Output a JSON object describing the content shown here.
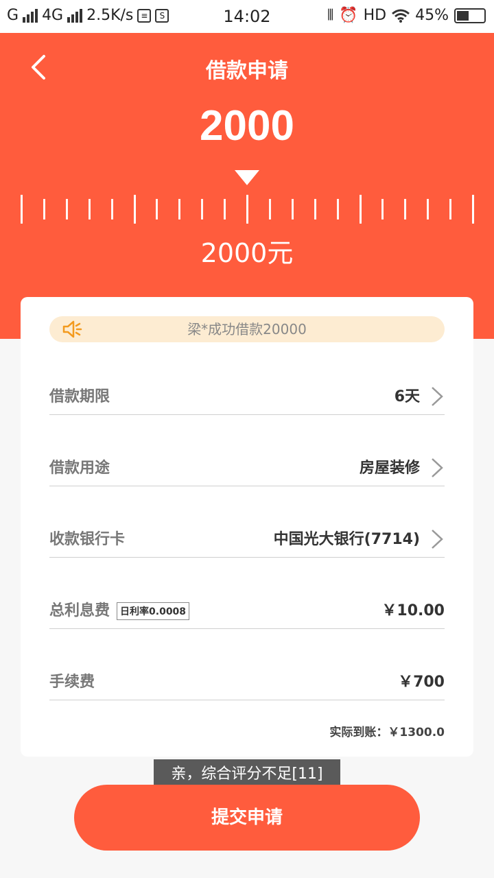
{
  "status_bar": {
    "carrier1": "G",
    "carrier2": "4G",
    "speed": "2.5K/s",
    "time": "14:02",
    "hd": "HD",
    "battery": "45%",
    "battery_level": 0.45
  },
  "header": {
    "title": "借款申请",
    "amount_big": "2000",
    "amount_label": "2000元",
    "bg_color": "#ff5c3d"
  },
  "card": {
    "notice": "梁*成功借款20000",
    "rows": [
      {
        "label": "借款期限",
        "value": "6天"
      },
      {
        "label": "借款用途",
        "value": "房屋装修"
      },
      {
        "label": "收款银行卡",
        "value": "中国光大银行(7714)"
      },
      {
        "label": "总利息费",
        "badge": "日利率0.0008",
        "value": "￥10.00"
      },
      {
        "label": "手续费",
        "value": "￥700"
      }
    ],
    "actual": "实际到账：￥1300.0"
  },
  "toast": "亲，综合评分不足[11]",
  "submit_label": "提交申请",
  "icons": [
    "back-icon",
    "speaker-icon",
    "chevron-right-icon",
    "wifi-icon",
    "alarm-icon",
    "vibrate-icon",
    "battery-icon"
  ]
}
